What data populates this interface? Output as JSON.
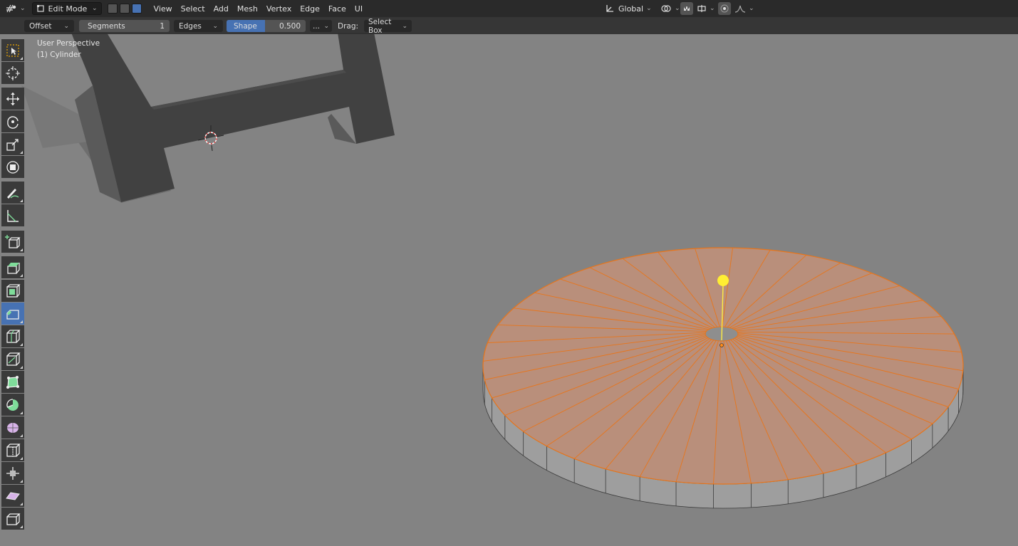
{
  "header": {
    "mode": "Edit Mode",
    "menus": [
      "View",
      "Select",
      "Add",
      "Mesh",
      "Vertex",
      "Edge",
      "Face",
      "UI"
    ],
    "transform_orientation": "Global"
  },
  "tool_settings": {
    "offset_type": "Offset",
    "segments_label": "Segments",
    "segments_value": "1",
    "affect": "Edges",
    "shape_label": "Shape",
    "shape_value": "0.500",
    "more": "...",
    "drag_label": "Drag:",
    "drag_value": "Select Box"
  },
  "viewport": {
    "perspective": "User Perspective",
    "object": "(1) Cylinder"
  },
  "toolbar_icons": [
    "select-box-icon",
    "cursor-icon",
    "move-icon",
    "rotate-icon",
    "scale-icon",
    "transform-icon",
    "annotate-icon",
    "measure-icon",
    "add-cube-icon",
    "extrude-icon",
    "inset-icon",
    "bevel-icon",
    "loop-cut-icon",
    "knife-icon",
    "poly-build-icon",
    "spin-icon",
    "smooth-icon",
    "edge-slide-icon",
    "shrink-fatten-icon",
    "shear-icon",
    "rip-icon"
  ],
  "colors": {
    "header_bg": "#2a2a2a",
    "accent_blue": "#4772b3",
    "selected_face": "#c99a7e",
    "selected_edge": "#e8751a",
    "gizmo": "#ffee44"
  }
}
